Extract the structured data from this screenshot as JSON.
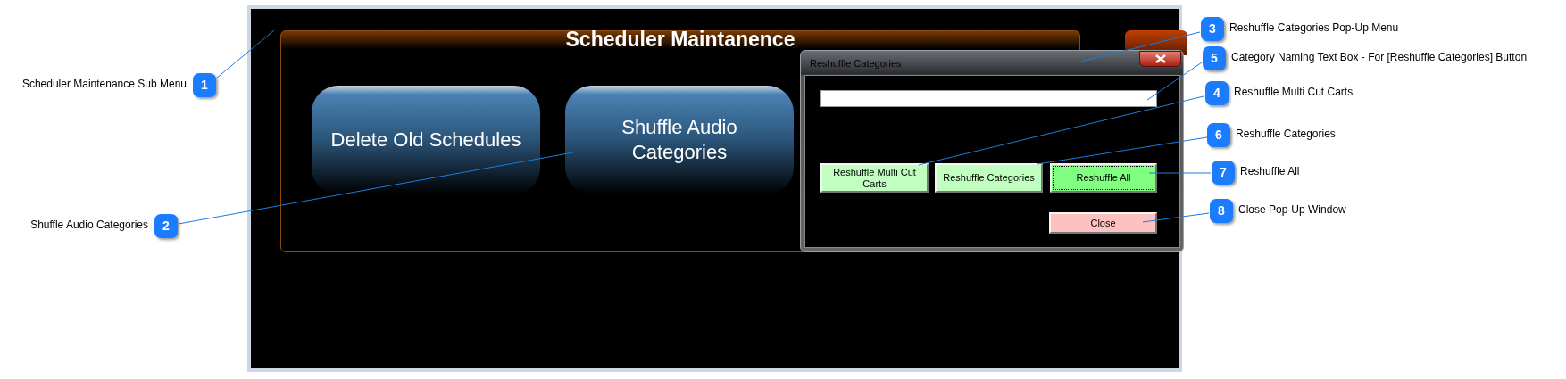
{
  "main_window": {
    "title": "Scheduler Maintanence",
    "buttons": [
      "Delete Old Schedules",
      "Shuffle Audio Categories"
    ]
  },
  "dialog": {
    "title": "Reshuffle Categories",
    "buttons": [
      {
        "label": "Reshuffle Multi Cut Carts",
        "color": "#c0ffc0",
        "focused": false
      },
      {
        "label": "Reshuffle Categories",
        "color": "#c0ffc0",
        "focused": false
      },
      {
        "label": "Reshuffle All",
        "color": "#80ff80",
        "focused": true
      },
      {
        "label": "Close",
        "color": "#ffc0c0",
        "focused": false
      }
    ]
  },
  "callouts": [
    {
      "number": "1",
      "label": "Scheduler Maintenance Sub Menu"
    },
    {
      "number": "2",
      "label": "Shuffle Audio Categories"
    },
    {
      "number": "3",
      "label": "Reshuffle Categories Pop-Up Menu"
    },
    {
      "number": "5",
      "label": "Category Naming Text Box - For [Reshuffle Categories] Button"
    },
    {
      "number": "4",
      "label": "Reshuffle Multi Cut Carts"
    },
    {
      "number": "6",
      "label": "Reshuffle Categories"
    },
    {
      "number": "7",
      "label": "Reshuffle All"
    },
    {
      "number": "8",
      "label": "Close Pop-Up Window"
    }
  ]
}
